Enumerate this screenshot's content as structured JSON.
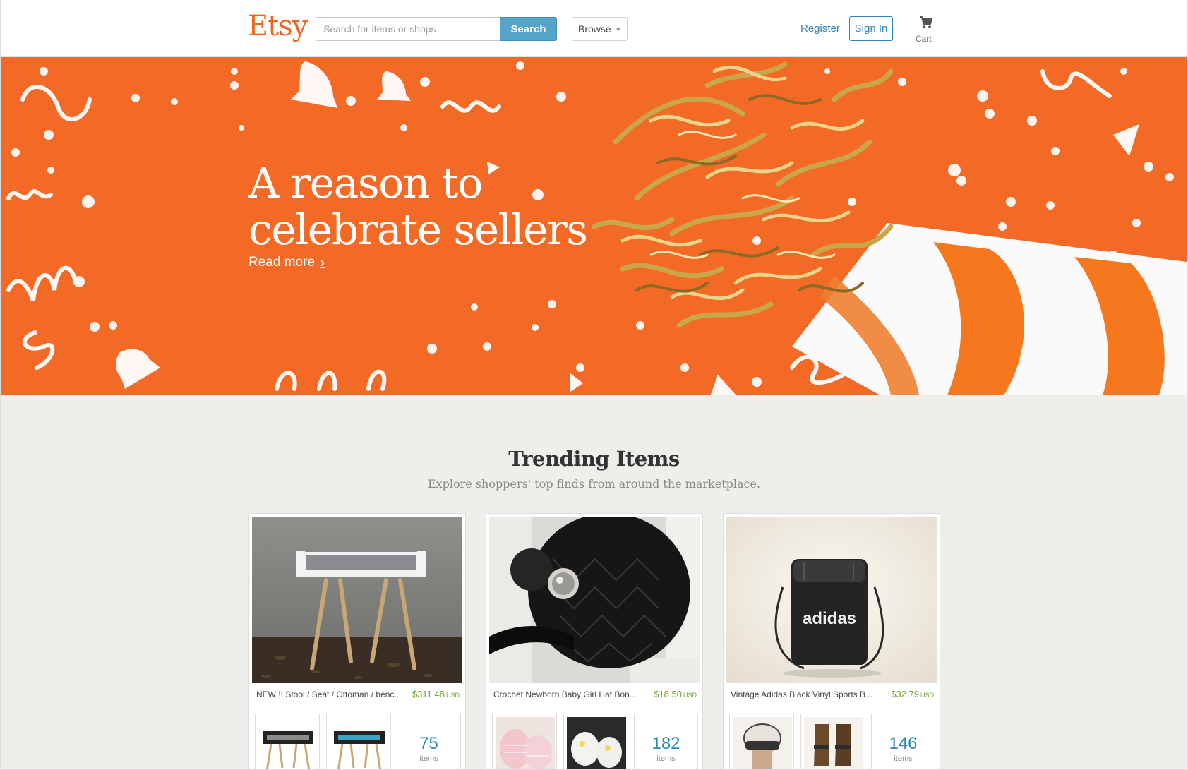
{
  "header": {
    "logo": "Etsy",
    "search_placeholder": "Search for items or shops",
    "search_button": "Search",
    "browse_label": "Browse",
    "register_label": "Register",
    "signin_label": "Sign In",
    "cart_label": "Cart",
    "brand_color": "#f1641e",
    "accent_color": "#54a5c9"
  },
  "hero": {
    "title_line1": "A reason to",
    "title_line2": "celebrate sellers",
    "link": "Read more",
    "background_color": "#f26a26"
  },
  "trending": {
    "title": "Trending Items",
    "subtitle": "Explore shoppers' top finds from around the marketplace.",
    "cards": [
      {
        "title": "NEW !! Stool / Seat / Ottoman / benc...",
        "price": "$311.48",
        "currency": "USD",
        "count": "75",
        "count_label": "items"
      },
      {
        "title": "Crochet Newborn Baby Girl Hat Bon...",
        "price": "$18.50",
        "currency": "USD",
        "count": "182",
        "count_label": "items"
      },
      {
        "title": "Vintage Adidas Black Vinyl Sports B...",
        "price": "$32.79",
        "currency": "USD",
        "count": "146",
        "count_label": "items"
      }
    ]
  },
  "icons": [
    "cart-icon",
    "chevron-down-icon",
    "chevron-right-icon"
  ]
}
